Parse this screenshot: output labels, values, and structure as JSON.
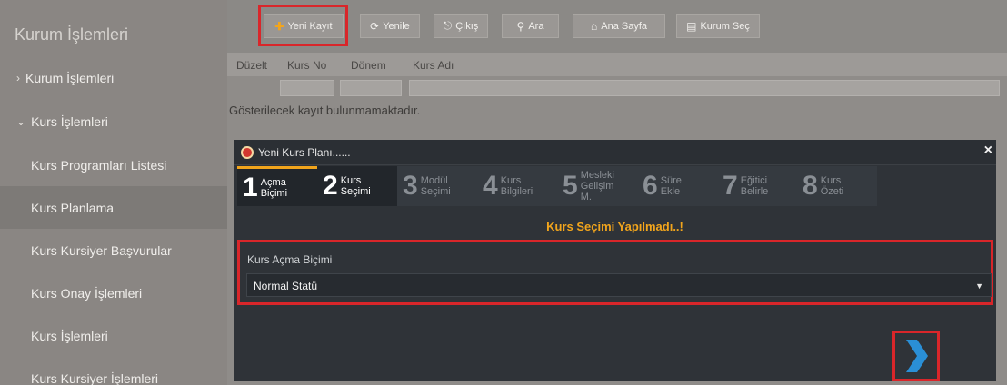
{
  "sidebar": {
    "title": "Kurum İşlemleri",
    "items": [
      {
        "label": "Kurum İşlemleri",
        "chevron": "›"
      },
      {
        "label": "Kurs İşlemleri",
        "chevron": "⌄"
      },
      {
        "label": "Kurs Programları Listesi"
      },
      {
        "label": "Kurs Planlama"
      },
      {
        "label": "Kurs Kursiyer Başvurular"
      },
      {
        "label": "Kurs Onay İşlemleri"
      },
      {
        "label": "Kurs İşlemleri"
      },
      {
        "label": "Kurs Kursiyer İşlemleri"
      }
    ]
  },
  "toolbar": {
    "new_label": "Yeni Kayıt",
    "refresh_label": "Yenile",
    "exit_label": "Çıkış",
    "search_label": "Ara",
    "home_label": "Ana Sayfa",
    "select_label": "Kurum Seç"
  },
  "grid": {
    "columns": [
      "Düzelt",
      "Kurs No",
      "Dönem",
      "Kurs Adı"
    ],
    "empty_message": "Gösterilecek kayıt bulunmamaktadır."
  },
  "dialog": {
    "title": "Yeni Kurs Planı......",
    "close": "×",
    "steps": [
      {
        "num": "1",
        "label1": "Açma",
        "label2": "Biçimi"
      },
      {
        "num": "2",
        "label1": "Kurs",
        "label2": "Seçimi"
      },
      {
        "num": "3",
        "label1": "Modül",
        "label2": "Seçimi"
      },
      {
        "num": "4",
        "label1": "Kurs",
        "label2": "Bilgileri"
      },
      {
        "num": "5",
        "label1": "Mesleki Gelişim",
        "label2": "M."
      },
      {
        "num": "6",
        "label1": "Süre",
        "label2": "Ekle"
      },
      {
        "num": "7",
        "label1": "Eğitici",
        "label2": "Belirle"
      },
      {
        "num": "8",
        "label1": "Kurs",
        "label2": "Özeti"
      }
    ],
    "warning": "Kurs Seçimi Yapılmadı..!",
    "field_label": "Kurs Açma Biçimi",
    "field_value": "Normal Statü"
  },
  "colors": {
    "accent": "#f2a51c",
    "highlight": "#d9262a",
    "next_arrow": "#2a8fd6"
  }
}
